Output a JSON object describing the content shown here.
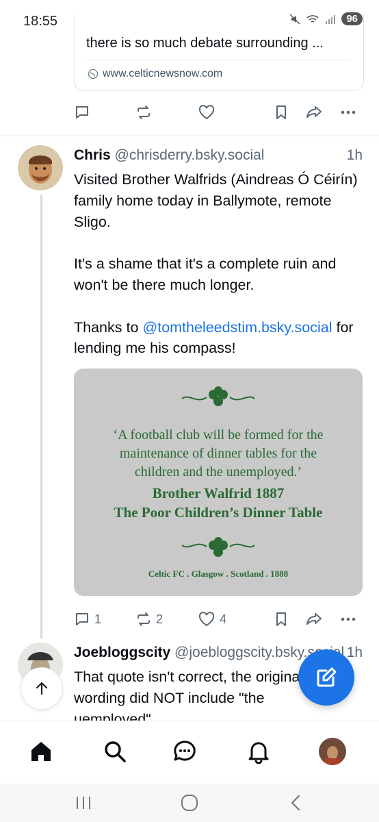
{
  "status_bar": {
    "time": "18:55",
    "battery": "96"
  },
  "link_card": {
    "description": "there is so much debate surrounding ...",
    "domain": "www.celticnewsnow.com"
  },
  "top_actions": {},
  "post": {
    "author_name": "Chris",
    "author_handle": "@chrisderry.bsky.social",
    "time": "1h",
    "text_p1": "Visited Brother Walfrids (Aindreas Ó Céirín) family home today in Ballymote, remote Sligo.",
    "text_p2": "It's a shame that it's a complete ruin and won't be there much longer.",
    "text_p3_before": "Thanks to ",
    "mention": "@tomtheleedstim.bsky.social",
    "text_p3_after": " for lending me his compass!",
    "embed": {
      "quote": "‘A football club will be formed for the maintenance of dinner tables for the children and the unemployed.’",
      "attribution_line1": "Brother Walfrid 1887",
      "attribution_line2": "The Poor Children’s Dinner Table",
      "footer": "Celtic FC . Glasgow . Scotland . 1888"
    },
    "reply_count": "1",
    "repost_count": "2",
    "like_count": "4"
  },
  "reply": {
    "author_name": "Joebloggscity",
    "author_handle": "@joebloggscity.bsky.social",
    "time": "1h",
    "text": "That quote isn't correct, the original wording did NOT include \"the uemployed\""
  },
  "colors": {
    "accent": "#1d74e6",
    "icon": "#5a6875"
  },
  "icons": [
    "reply-icon",
    "repost-icon",
    "like-icon",
    "bookmark-icon",
    "share-icon",
    "more-icon",
    "home-icon",
    "search-icon",
    "chat-icon",
    "notifications-icon",
    "compose-icon",
    "arrow-up-icon"
  ]
}
